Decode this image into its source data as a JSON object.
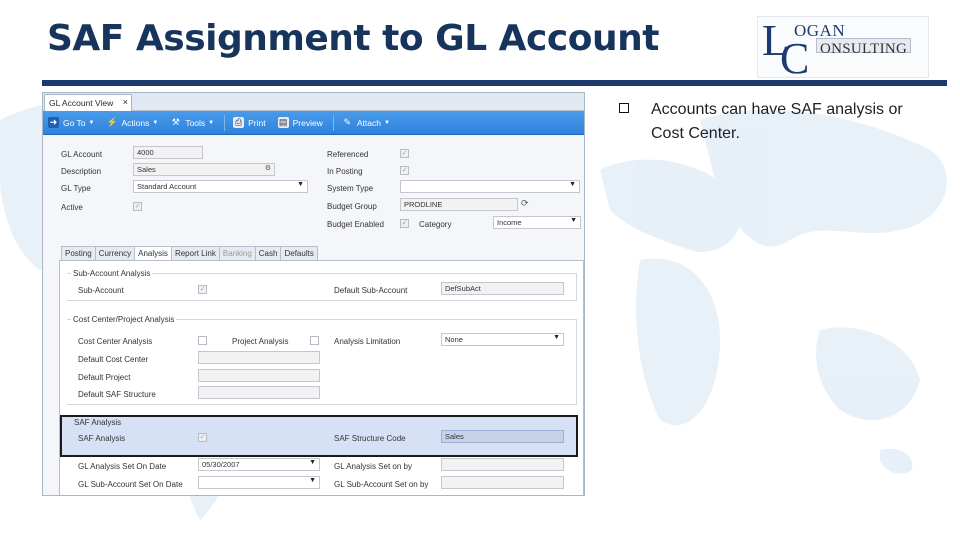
{
  "slide": {
    "title": "SAF Assignment to GL Account",
    "bullet": "Accounts can have SAF analysis or Cost Center.",
    "logo": {
      "letter1": "L",
      "letter2": "C",
      "line1": "OGAN",
      "line2": "ONSULTING"
    },
    "colors": {
      "title": "#17345c",
      "rule": "#1d3a6e",
      "toolbar": "#3a8ee3",
      "highlight": "#d7e1f6"
    }
  },
  "window": {
    "tab": "GL Account View",
    "close": "×",
    "toolbar": [
      {
        "label": "Go To",
        "icon": "arrow-icon",
        "dropdown": "▼"
      },
      {
        "label": "Actions",
        "icon": "lightning-icon",
        "dropdown": "▼"
      },
      {
        "label": "Tools",
        "icon": "tools-icon",
        "dropdown": "▼"
      },
      {
        "label": "Print",
        "icon": "printer-icon"
      },
      {
        "label": "Preview",
        "icon": "preview-icon"
      },
      {
        "label": "Attach",
        "icon": "paperclip-icon",
        "dropdown": "▼"
      }
    ],
    "header": {
      "gl_account_label": "GL Account",
      "gl_account_value": "4000",
      "description_label": "Description",
      "description_value": "Sales",
      "gl_type_label": "GL Type",
      "gl_type_value": "Standard Account",
      "active_label": "Active",
      "referenced_label": "Referenced",
      "in_posting_label": "In Posting",
      "system_type_label": "System Type",
      "system_type_value": "",
      "budget_group_label": "Budget Group",
      "budget_group_value": "PRODLINE",
      "budget_enabled_label": "Budget Enabled",
      "category_label": "Category",
      "category_value": "Income"
    },
    "tabs": [
      {
        "label": "Posting",
        "state": "normal"
      },
      {
        "label": "Currency",
        "state": "normal"
      },
      {
        "label": "Analysis",
        "state": "active"
      },
      {
        "label": "Report Link",
        "state": "normal"
      },
      {
        "label": "Banking",
        "state": "grey"
      },
      {
        "label": "Cash",
        "state": "normal"
      },
      {
        "label": "Defaults",
        "state": "normal"
      }
    ],
    "sub_account": {
      "title": "Sub-Account Analysis",
      "sub_account_label": "Sub-Account",
      "default_sub_account_label": "Default Sub-Account",
      "default_sub_account_value": "DefSubAct"
    },
    "cost_center": {
      "title": "Cost Center/Project Analysis",
      "cost_center_analysis_label": "Cost Center Analysis",
      "project_analysis_label": "Project Analysis",
      "analysis_limitation_label": "Analysis Limitation",
      "analysis_limitation_value": "None",
      "default_cost_center_label": "Default Cost Center",
      "default_project_label": "Default Project",
      "default_saf_structure_label": "Default SAF Structure"
    },
    "saf": {
      "title": "SAF Analysis",
      "saf_analysis_label": "SAF Analysis",
      "saf_structure_code_label": "SAF Structure Code",
      "saf_structure_code_value": "Sales"
    },
    "footer": {
      "analysis_set_on_date_label": "GL Analysis Set On Date",
      "analysis_set_on_date_value": "05/30/2007",
      "analysis_set_on_by_label": "GL Analysis Set on by",
      "sub_account_set_on_date_label": "GL Sub-Account Set On Date",
      "sub_account_set_on_by_label": "GL Sub-Account Set on by"
    }
  }
}
